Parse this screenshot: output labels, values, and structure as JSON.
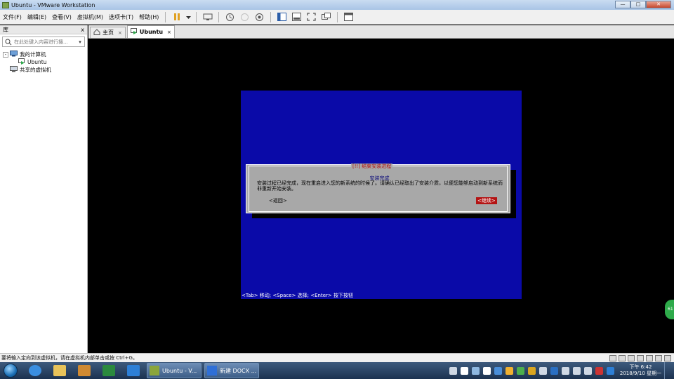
{
  "window": {
    "title": "Ubuntu - VMware Workstation",
    "controls": [
      "—",
      "□",
      "✕"
    ]
  },
  "menu": {
    "items": [
      "文件(F)",
      "编辑(E)",
      "查看(V)",
      "虚拟机(M)",
      "选项卡(T)",
      "帮助(H)"
    ]
  },
  "toolbar": {
    "buttons": [
      "pause-icon",
      "dropdown-icon",
      "send-ctrl-alt-del-icon",
      "snapshot-icon",
      "revert-snapshot-icon",
      "snapshot-manager-icon",
      "library-view-icon",
      "console-view-icon",
      "fullscreen-icon",
      "unity-icon",
      "thumbnail-icon"
    ]
  },
  "library": {
    "title": "库",
    "close": "x",
    "search_placeholder": "在此处键入内容进行搜...",
    "tree": {
      "root": "我的计算机",
      "child": "Ubuntu",
      "shared": "共享的虚拟机",
      "expand": "-"
    }
  },
  "tabs": {
    "home": "主页",
    "vm": "Ubuntu",
    "close": "×"
  },
  "installer": {
    "dialog_title": "[!!] 结束安装进程",
    "subtitle": "安装完成",
    "body": "安装过程已经完成，现在重启进入您的新系统的时候了。请确认已经取出了安装介质，以便您能够启动到新系统而非重新开始安装。",
    "back_button": "<返回>",
    "continue_button": "<继续>",
    "hint": "<Tab> 移动; <Space> 选择; <Enter> 按下按钮"
  },
  "side_badge": "61",
  "statusbar": {
    "message": "要将输入定向到该虚拟机，请在虚拟机内部单击或按 Ctrl+G。"
  },
  "taskbar": {
    "tasks": [
      "Ubuntu - V...",
      "新建 DOCX ..."
    ],
    "clock_time": "下午 6:42",
    "clock_date": "2018/9/10 星期一"
  },
  "colors": {
    "installer_bg": "#0a0aa8",
    "dialog_bg": "#a8a8a8",
    "accent_red": "#b41414"
  }
}
